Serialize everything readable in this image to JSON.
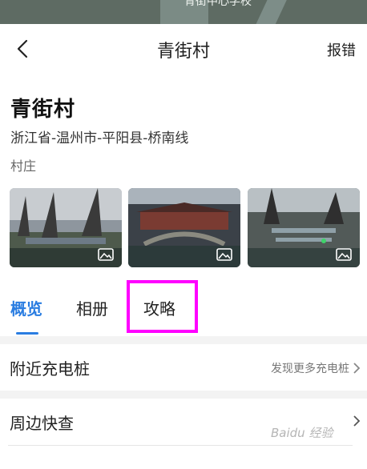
{
  "map": {
    "label": "青街中心学校"
  },
  "topbar": {
    "title": "青街村",
    "report": "报错"
  },
  "place": {
    "name": "青街村",
    "address": "浙江省-温州市-平阳县-桥南线",
    "category": "村庄"
  },
  "photos": [
    {
      "icon": "image-icon"
    },
    {
      "icon": "image-icon"
    },
    {
      "icon": "image-icon"
    }
  ],
  "tabs": [
    {
      "label": "概览",
      "active": true
    },
    {
      "label": "相册",
      "active": false
    },
    {
      "label": "攻略",
      "active": false
    }
  ],
  "rows": {
    "charging": {
      "title": "附近充电桩",
      "action": "发现更多充电桩"
    },
    "nearby": {
      "title": "周边快查"
    }
  },
  "watermark": "Baidu 经验",
  "colors": {
    "accent": "#2a7de1",
    "highlight": "#ff00ff"
  }
}
